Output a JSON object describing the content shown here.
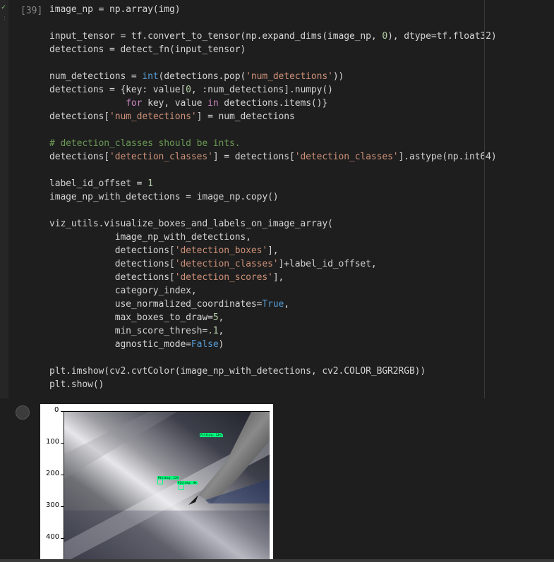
{
  "cell": {
    "execution_count": "[39]",
    "status_icon": "check-icon",
    "code_lines": [
      [
        {
          "t": "image_np = np.array(img)",
          "c": ""
        }
      ],
      [
        {
          "t": "",
          "c": ""
        }
      ],
      [
        {
          "t": "input_tensor = tf.convert_to_tensor(np.expand_dims(image_np, ",
          "c": ""
        },
        {
          "t": "0",
          "c": "n"
        },
        {
          "t": "), dtype=tf.float32)",
          "c": ""
        }
      ],
      [
        {
          "t": "detections = detect_fn(input_tensor)",
          "c": ""
        }
      ],
      [
        {
          "t": "",
          "c": ""
        }
      ],
      [
        {
          "t": "num_detections = ",
          "c": ""
        },
        {
          "t": "int",
          "c": "k"
        },
        {
          "t": "(detections.pop(",
          "c": ""
        },
        {
          "t": "'num_detections'",
          "c": "s"
        },
        {
          "t": "))",
          "c": ""
        }
      ],
      [
        {
          "t": "detections = {key: value[",
          "c": ""
        },
        {
          "t": "0",
          "c": "n"
        },
        {
          "t": ", :num_detections].numpy()",
          "c": ""
        }
      ],
      [
        {
          "t": "              ",
          "c": ""
        },
        {
          "t": "for",
          "c": "kw"
        },
        {
          "t": " key, value ",
          "c": ""
        },
        {
          "t": "in",
          "c": "kw"
        },
        {
          "t": " detections.items()}",
          "c": ""
        }
      ],
      [
        {
          "t": "detections[",
          "c": ""
        },
        {
          "t": "'num_detections'",
          "c": "s"
        },
        {
          "t": "] = num_detections",
          "c": ""
        }
      ],
      [
        {
          "t": "",
          "c": ""
        }
      ],
      [
        {
          "t": "# detection_classes should be ints.",
          "c": "c"
        }
      ],
      [
        {
          "t": "detections[",
          "c": ""
        },
        {
          "t": "'detection_classes'",
          "c": "s"
        },
        {
          "t": "] = detections[",
          "c": ""
        },
        {
          "t": "'detection_classes'",
          "c": "s"
        },
        {
          "t": "].astype(np.int64)",
          "c": ""
        }
      ],
      [
        {
          "t": "",
          "c": ""
        }
      ],
      [
        {
          "t": "label_id_offset = ",
          "c": ""
        },
        {
          "t": "1",
          "c": "n"
        }
      ],
      [
        {
          "t": "image_np_with_detections = image_np.copy()",
          "c": ""
        }
      ],
      [
        {
          "t": "",
          "c": ""
        }
      ],
      [
        {
          "t": "viz_utils.visualize_boxes_and_labels_on_image_array(",
          "c": ""
        }
      ],
      [
        {
          "t": "            image_np_with_detections,",
          "c": ""
        }
      ],
      [
        {
          "t": "            detections[",
          "c": ""
        },
        {
          "t": "'detection_boxes'",
          "c": "s"
        },
        {
          "t": "],",
          "c": ""
        }
      ],
      [
        {
          "t": "            detections[",
          "c": ""
        },
        {
          "t": "'detection_classes'",
          "c": "s"
        },
        {
          "t": "]+label_id_offset,",
          "c": ""
        }
      ],
      [
        {
          "t": "            detections[",
          "c": ""
        },
        {
          "t": "'detection_scores'",
          "c": "s"
        },
        {
          "t": "],",
          "c": ""
        }
      ],
      [
        {
          "t": "            category_index,",
          "c": ""
        }
      ],
      [
        {
          "t": "            use_normalized_coordinates=",
          "c": ""
        },
        {
          "t": "True",
          "c": "b"
        },
        {
          "t": ",",
          "c": ""
        }
      ],
      [
        {
          "t": "            max_boxes_to_draw=",
          "c": ""
        },
        {
          "t": "5",
          "c": "n"
        },
        {
          "t": ",",
          "c": ""
        }
      ],
      [
        {
          "t": "            min_score_thresh=",
          "c": ""
        },
        {
          "t": ".1",
          "c": "n"
        },
        {
          "t": ",",
          "c": ""
        }
      ],
      [
        {
          "t": "            agnostic_mode=",
          "c": ""
        },
        {
          "t": "False",
          "c": "b"
        },
        {
          "t": ")",
          "c": ""
        }
      ],
      [
        {
          "t": "",
          "c": ""
        }
      ],
      [
        {
          "t": "plt.imshow(cv2.cvtColor(image_np_with_detections, cv2.COLOR_BGR2RGB))",
          "c": ""
        }
      ],
      [
        {
          "t": "plt.show()",
          "c": ""
        }
      ]
    ]
  },
  "output": {
    "y_ticks": [
      "0",
      "100",
      "200",
      "300",
      "400"
    ],
    "detections": [
      {
        "label": "Pitting: 13%"
      },
      {
        "label": "Pitting: 12%"
      },
      {
        "label": "Pitting: 4%"
      }
    ]
  },
  "colors": {
    "background": "#1e1e1e",
    "detection_box": "#00ff7f"
  }
}
